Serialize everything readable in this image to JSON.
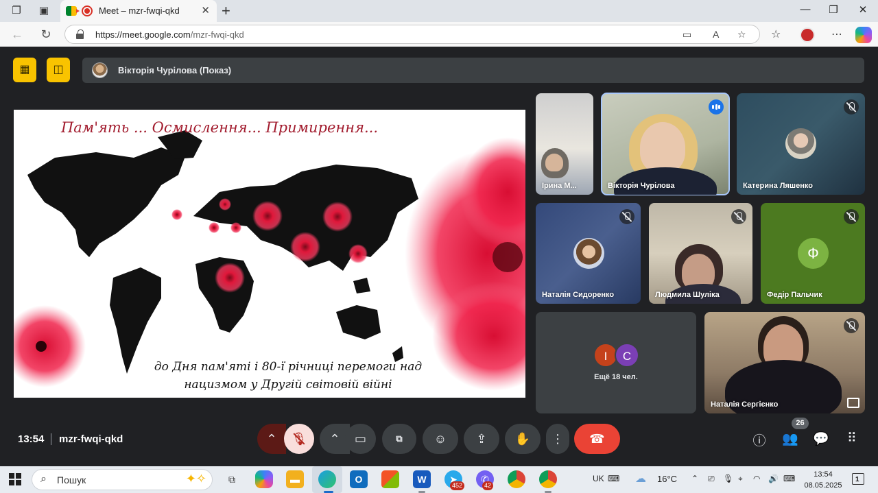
{
  "browser": {
    "tab_title": "Meet – mzr-fwqi-qkd",
    "tab_close": "✕",
    "new_tab": "+",
    "url_host": "https://meet.google.com",
    "url_path": "/mzr-fwqi-qkd",
    "icons": [
      "workspaces-icon",
      "tab-actions-icon",
      "back-icon",
      "refresh-icon",
      "camera-site-icon",
      "read-aloud-icon",
      "favorite-star-icon",
      "favorites-icon",
      "profile-icon",
      "more-icon",
      "copilot-icon"
    ]
  },
  "meet": {
    "presenter_label": "Вікторія Чурілова (Показ)",
    "slide": {
      "title": "Пам'ять ... Осмислення... Примирення...",
      "caption": "до Дня пам'яті і 80-ї річниці перемоги над нацизмом у Другій світовій війні"
    },
    "participants": [
      {
        "name": "Ірина М...",
        "muted": false
      },
      {
        "name": "Вікторія Чурілова",
        "speaking": true
      },
      {
        "name": "Катерина Ляшенко",
        "muted": true
      },
      {
        "name": "Наталія Сидоренко",
        "muted": true
      },
      {
        "name": "Людмила Шуліка",
        "muted": true
      },
      {
        "name": "Федір Пальчик",
        "initial": "Ф",
        "muted": true
      },
      {
        "name": "Наталія Сергієнко",
        "muted": true
      }
    ],
    "more_tile": {
      "initials": [
        "I",
        "C"
      ],
      "text": "Ещё 18 чел."
    },
    "bottom": {
      "time": "13:54",
      "code": "mzr-fwqi-qkd",
      "participant_count": "26"
    },
    "colors": {
      "leave_red": "#ea4335",
      "mic_muted_bg": "#f9dedc",
      "yellow": "#f9c300",
      "active_outline": "#a8c7fa"
    }
  },
  "taskbar": {
    "search_text": "Пошук",
    "badges": {
      "telegram": "452",
      "viber": "42"
    },
    "language": "UK",
    "weather": "16°C",
    "clock_time": "13:54",
    "clock_date": "08.05.2025",
    "notifications": "1"
  }
}
